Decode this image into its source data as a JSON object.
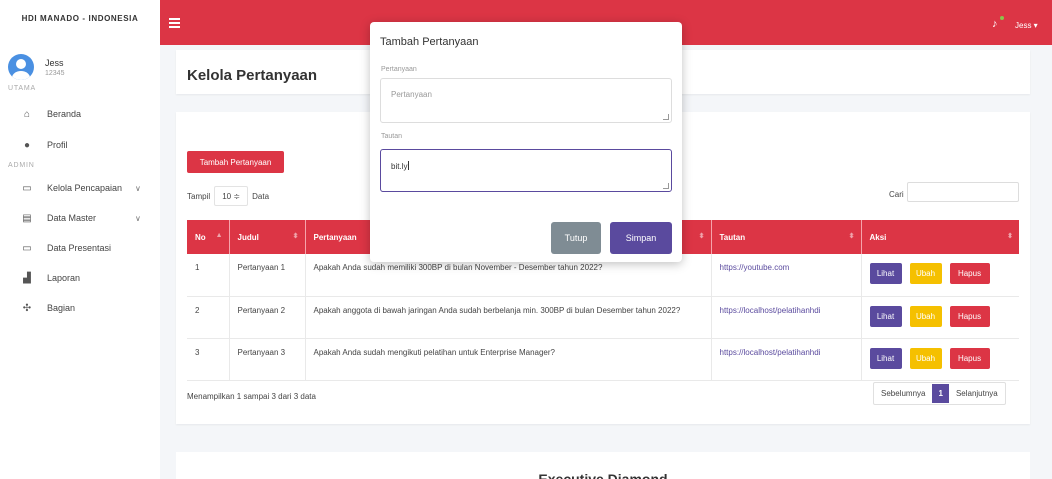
{
  "sidebar": {
    "brand": "HDI MANADO - INDONESIA",
    "user_name": "Jess",
    "user_id": "12345",
    "section_main": "UTAMA",
    "section_admin": "ADMIN",
    "items": [
      {
        "label": "Beranda",
        "icon": "home-icon"
      },
      {
        "label": "Profil",
        "icon": "user-icon"
      },
      {
        "label": "Kelola Pencapaian",
        "icon": "calendar-icon"
      },
      {
        "label": "Data Master",
        "icon": "clipboard-icon"
      },
      {
        "label": "Data Presentasi",
        "icon": "monitor-icon"
      },
      {
        "label": "Laporan",
        "icon": "bar-chart-icon"
      },
      {
        "label": "Bagian",
        "icon": "puzzle-icon"
      }
    ]
  },
  "topbar": {
    "user_label": "Jess ▾",
    "accent": "#dc3545"
  },
  "page": {
    "title": "Kelola Pertanyaan",
    "add_button": "Tambah Pertanyaan",
    "show_label": "Tampil",
    "show_value": "10 ≑",
    "show_suffix": "Data",
    "search_label": "Cari"
  },
  "table": {
    "headers": [
      "No",
      "Judul",
      "Pertanyaan",
      "Tautan",
      "Aksi"
    ],
    "rows": [
      {
        "no": "1",
        "judul": "Pertanyaan 1",
        "pertanyaan": "Apakah Anda sudah memiliki 300BP di bulan November - Desember tahun 2022?",
        "tautan": "https://youtube.com"
      },
      {
        "no": "2",
        "judul": "Pertanyaan 2",
        "pertanyaan": "Apakah anggota di bawah jaringan Anda sudah berbelanja min. 300BP di bulan Desember tahun 2022?",
        "tautan": "https://localhost/pelatihanhdi"
      },
      {
        "no": "3",
        "judul": "Pertanyaan 3",
        "pertanyaan": "Apakah Anda sudah mengikuti pelatihan untuk Enterprise Manager?",
        "tautan": "https://localhost/pelatihanhdi"
      }
    ],
    "action_view": "Lihat",
    "action_edit": "Ubah",
    "action_delete": "Hapus"
  },
  "footer": {
    "info": "Menampilkan 1 sampai 3 dari 3 data",
    "prev": "Sebelumnya",
    "page": "1",
    "next": "Selanjutnya"
  },
  "lower_card": {
    "title": "Executive Diamond"
  },
  "modal": {
    "title": "Tambah Pertanyaan",
    "question_label": "Pertanyaan",
    "question_placeholder": "Pertanyaan",
    "link_label": "Tautan",
    "link_value": "bit.ly",
    "close_button": "Tutup",
    "save_button": "Simpan"
  }
}
